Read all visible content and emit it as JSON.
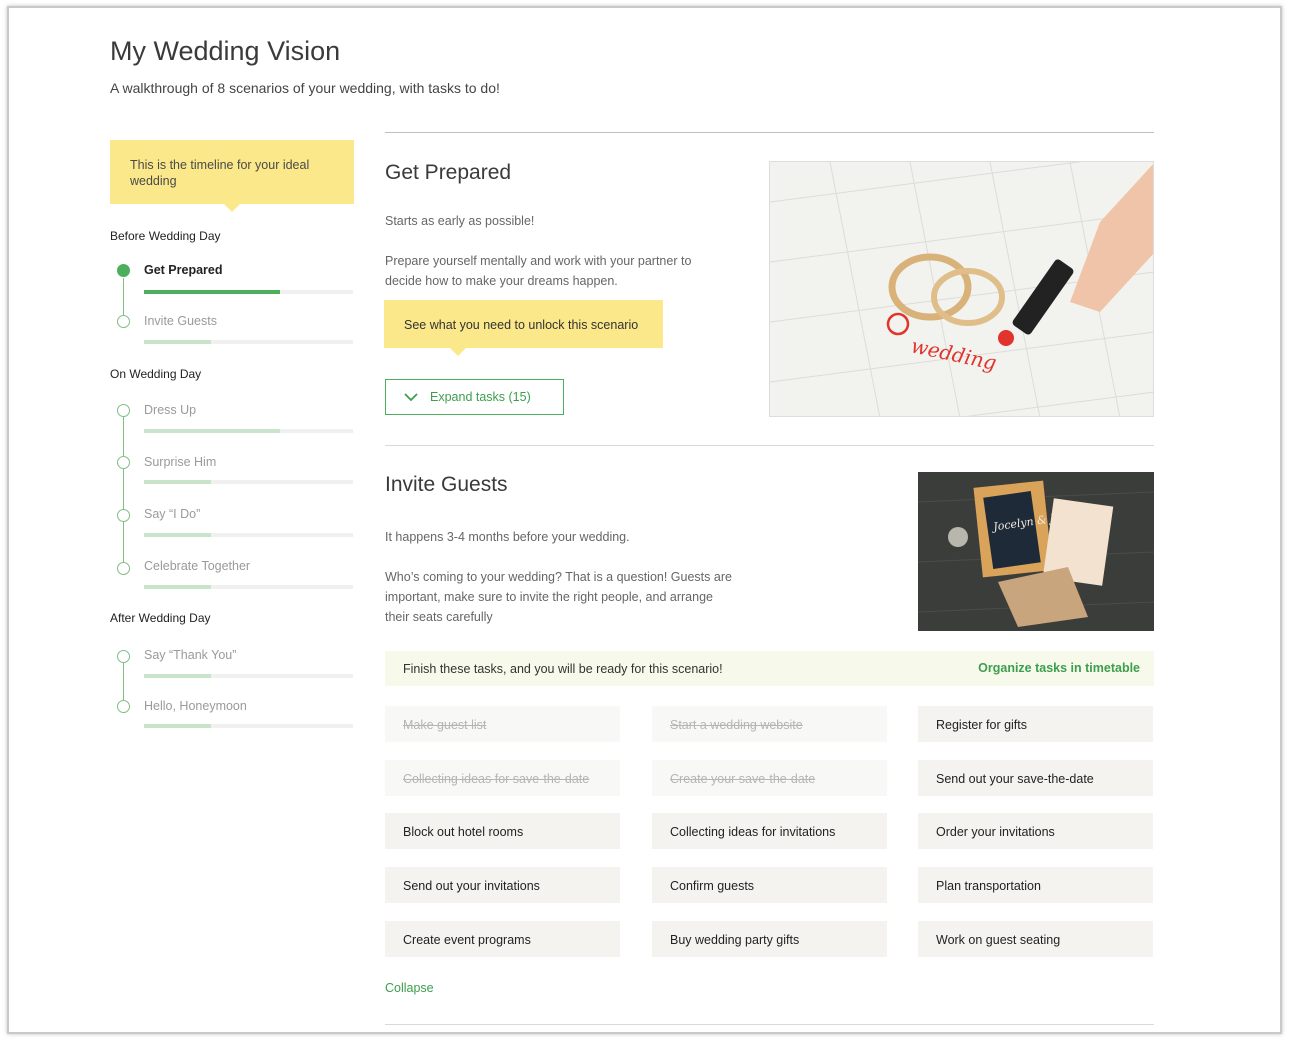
{
  "page": {
    "title": "My Wedding Vision",
    "subtitle": "A walkthrough of 8 scenarios of your wedding, with tasks to do!"
  },
  "sidebar": {
    "tip": "This is the timeline for your ideal wedding",
    "sections": [
      {
        "label": "Before Wedding Day",
        "items": [
          {
            "label": "Get Prepared",
            "active": true,
            "progress": 0.65
          },
          {
            "label": "Invite Guests",
            "active": false,
            "progress": 0.32
          }
        ]
      },
      {
        "label": "On Wedding Day",
        "items": [
          {
            "label": "Dress Up",
            "active": false,
            "progress": 0.65
          },
          {
            "label": "Surprise Him",
            "active": false,
            "progress": 0.32
          },
          {
            "label": "Say “I Do”",
            "active": false,
            "progress": 0.32
          },
          {
            "label": "Celebrate Together",
            "active": false,
            "progress": 0.32
          }
        ]
      },
      {
        "label": "After Wedding Day",
        "items": [
          {
            "label": "Say “Thank You”",
            "active": false,
            "progress": 0.32
          },
          {
            "label": "Hello, Honeymoon",
            "active": false,
            "progress": 0.32
          }
        ]
      }
    ]
  },
  "scenarios": [
    {
      "title": "Get Prepared",
      "timing": "Starts as early as possible!",
      "description": "Prepare yourself mentally and work with your partner to decide how to make your dreams happen.",
      "unlock": "See what you need to unlock this scenario",
      "expand_label": "Expand tasks (15)",
      "image_text": "wedding"
    },
    {
      "title": "Invite Guests",
      "timing": "It happens 3-4 months before your wedding.",
      "description": "Who’s coming to your wedding? That is a question! Guests are important, make sure to invite the right people, and arrange their seats carefully",
      "image_text": "Jocelyn & Jeff",
      "finish_text": "Finish these tasks, and you will be ready for this scenario!",
      "organize_link": "Organize tasks in timetable",
      "tasks": [
        {
          "label": "Make guest list",
          "done": true
        },
        {
          "label": "Start a wedding website",
          "done": true
        },
        {
          "label": "Register for gifts",
          "done": false
        },
        {
          "label": "Collecting ideas for save-the-date",
          "done": true
        },
        {
          "label": "Create your save-the-date",
          "done": true
        },
        {
          "label": "Send out your save-the-date",
          "done": false
        },
        {
          "label": "Block out hotel rooms",
          "done": false
        },
        {
          "label": "Collecting ideas for invitations",
          "done": false
        },
        {
          "label": "Order your invitations",
          "done": false
        },
        {
          "label": "Send out your invitations",
          "done": false
        },
        {
          "label": "Confirm guests",
          "done": false
        },
        {
          "label": "Plan transportation",
          "done": false
        },
        {
          "label": "Create event programs",
          "done": false
        },
        {
          "label": "Buy wedding party gifts",
          "done": false
        },
        {
          "label": "Work on guest seating",
          "done": false
        }
      ],
      "collapse_label": "Collapse"
    }
  ],
  "colors": {
    "accent": "#4caf5c",
    "highlight": "#fbe88a",
    "finish_bar": "#f7f9ea"
  }
}
